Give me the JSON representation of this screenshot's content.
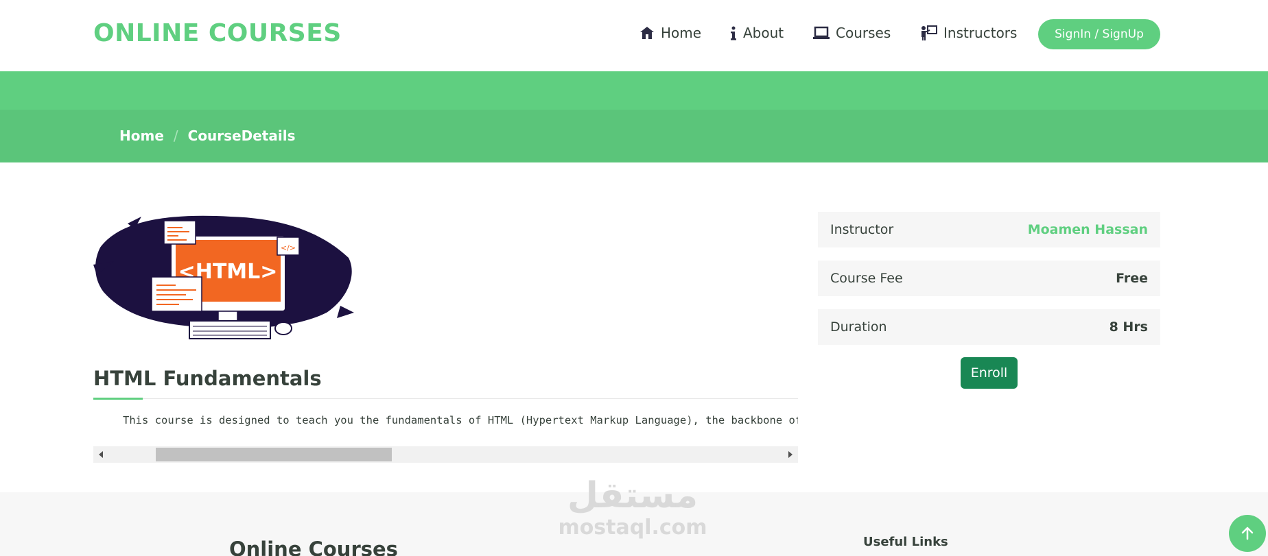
{
  "header": {
    "logo": "ONLINE COURSES",
    "nav": [
      {
        "label": "Home",
        "icon": "home-icon"
      },
      {
        "label": "About",
        "icon": "info-icon"
      },
      {
        "label": "Courses",
        "icon": "laptop-icon"
      },
      {
        "label": "Instructors",
        "icon": "presenter-icon"
      }
    ],
    "signin_label": "SignIn / SignUp"
  },
  "breadcrumb": {
    "home": "Home",
    "separator": "/",
    "current": "CourseDetails"
  },
  "course": {
    "image_text": "<HTML>",
    "image_tag": "</>",
    "title": "HTML Fundamentals",
    "description": "This course is designed to teach you the fundamentals of HTML (Hypertext Markup Language), the backbone of"
  },
  "info": {
    "rows": [
      {
        "label": "Instructor",
        "value": "Moamen Hassan"
      },
      {
        "label": "Course Fee",
        "value": "Free"
      },
      {
        "label": "Duration",
        "value": "8 Hrs"
      }
    ],
    "enroll_label": "Enroll"
  },
  "scrollbar": {
    "thumb_position_fraction": 0.07,
    "thumb_size_fraction": 0.35
  },
  "footer": {
    "brand": "Online Courses",
    "links_heading": "Useful Links"
  },
  "watermark": {
    "arabic": "مستقل",
    "latin": "mostaql.com"
  },
  "colors": {
    "accent": "#5fcf80",
    "accent_dark": "#5bc57a",
    "enroll": "#198754",
    "text": "#37423b"
  }
}
